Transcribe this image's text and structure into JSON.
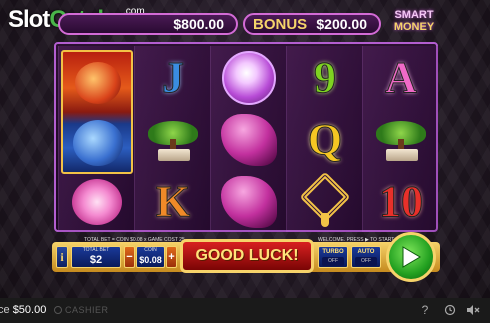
{
  "header": {
    "logo_main": "Slot",
    "logo_accent": "Catalog",
    "logo_suffix": ".com",
    "balance_display": "$800.00",
    "bonus_label": "BONUS",
    "bonus_value": "$200.00",
    "smart_label": "SMART",
    "money_label": "MONEY"
  },
  "reels": {
    "col1": [
      "dragon-stacked",
      "dragon-stacked",
      "peony"
    ],
    "col2": [
      "J",
      "bonsai",
      "K"
    ],
    "col3": [
      "pearl",
      "crane",
      "crane"
    ],
    "col4": [
      "9",
      "Q",
      "knot"
    ],
    "col5": [
      "A",
      "bonsai",
      "10"
    ]
  },
  "symbols": {
    "J": "J",
    "K": "K",
    "nine": "9",
    "Q": "Q",
    "A": "A",
    "ten": "10"
  },
  "info": {
    "left_text": "TOTAL BET = COIN $0.08 x GAME COST 25",
    "right_text": "WELCOME. PRESS ▶ TO START"
  },
  "controls": {
    "info_button": "i",
    "total_bet_label": "TOTAL BET",
    "total_bet_value": "$2",
    "coin_label": "COIN",
    "coin_value": "$0.08",
    "minus": "−",
    "plus": "+",
    "message": "GOOD LUCK!",
    "turbo_label": "TURBO",
    "turbo_state": "OFF",
    "auto_label": "AUTO",
    "auto_state": "OFF"
  },
  "footer": {
    "balance_label": "ce",
    "balance_value": "$50.00",
    "cashier_label": "CASHIER"
  },
  "colors": {
    "frame": "#b35ed0",
    "gold": "#f6d36a",
    "spin_green": "#22a020"
  }
}
